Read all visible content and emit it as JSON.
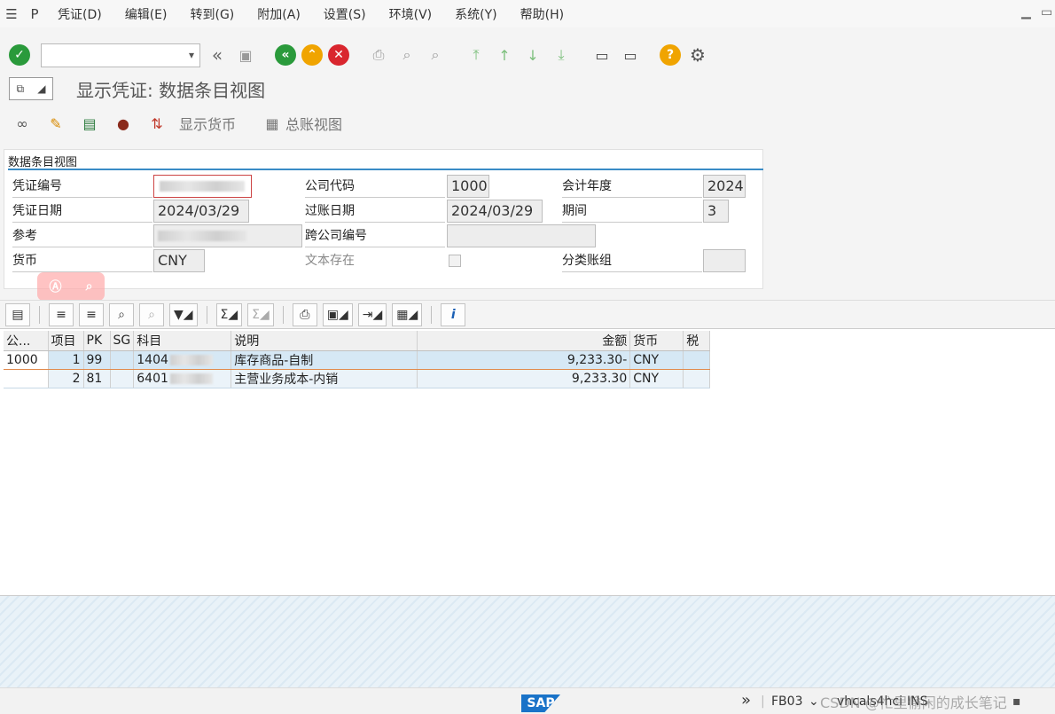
{
  "menu": {
    "items": [
      "凭证(D)",
      "编辑(E)",
      "转到(G)",
      "附加(A)",
      "设置(S)",
      "环境(V)",
      "系统(Y)",
      "帮助(H)"
    ]
  },
  "toolbar": {
    "command_value": "",
    "icons": [
      "check-icon",
      "back-icon",
      "save-icon",
      "exit-icon",
      "up-icon",
      "cancel-icon",
      "print-icon",
      "find-icon",
      "find-next-icon",
      "first-page-icon",
      "prev-page-icon",
      "next-page-icon",
      "last-page-icon",
      "new-session-icon",
      "shortcut-icon",
      "help-icon",
      "settings-icon"
    ]
  },
  "title": "显示凭证: 数据条目视图",
  "app_toolbar": {
    "display_currency": "显示货币",
    "general_ledger_view": "总账视图"
  },
  "group": {
    "title": "数据条目视图",
    "doc_no_label": "凭证编号",
    "company_code_label": "公司代码",
    "company_code": "1000",
    "fiscal_year_label": "会计年度",
    "fiscal_year": "2024",
    "doc_date_label": "凭证日期",
    "doc_date": "2024/03/29",
    "posting_date_label": "过账日期",
    "posting_date": "2024/03/29",
    "period_label": "期间",
    "period": "3",
    "reference_label": "参考",
    "cross_cc_label": "跨公司编号",
    "currency_label": "货币",
    "currency": "CNY",
    "text_exists_label": "文本存在",
    "ledger_group_label": "分类账组"
  },
  "grid": {
    "headers": [
      "公...",
      "项目",
      "PK",
      "SG",
      "科目",
      "说明",
      "金额",
      "货币",
      "税"
    ],
    "rows": [
      {
        "company": "1000",
        "item": "1",
        "pk": "99",
        "sg": "",
        "account": "1404",
        "desc": "库存商品-自制",
        "amount": "9,233.30-",
        "currency": "CNY",
        "tax": ""
      },
      {
        "company": "",
        "item": "2",
        "pk": "81",
        "sg": "",
        "account": "6401",
        "desc": "主营业务成本-内销",
        "amount": "9,233.30",
        "currency": "CNY",
        "tax": ""
      }
    ]
  },
  "status": {
    "logo": "SAP",
    "tcode": "FB03",
    "server": "vhcals4hci",
    "mode": "INS",
    "watermark": "CSDN @忙里偷闲的成长笔记"
  }
}
